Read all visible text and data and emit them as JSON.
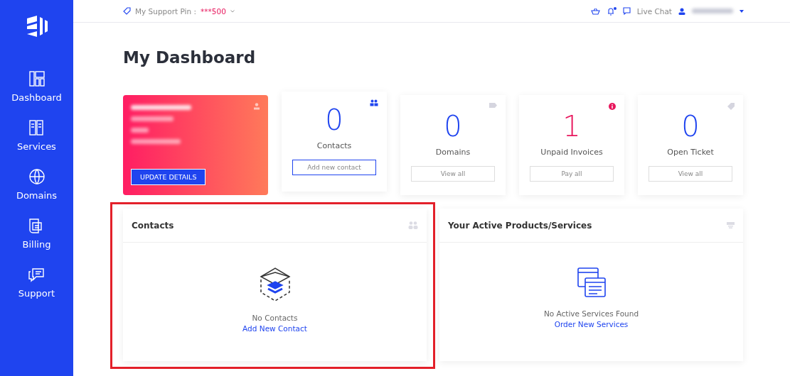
{
  "sidebar": {
    "items": [
      {
        "label": "Dashboard"
      },
      {
        "label": "Services"
      },
      {
        "label": "Domains"
      },
      {
        "label": "Billing"
      },
      {
        "label": "Support"
      }
    ]
  },
  "topbar": {
    "pin_label": "My Support Pin :",
    "pin_value": "***500",
    "live_chat": "Live Chat",
    "notification_dot": true
  },
  "title": "My Dashboard",
  "profile_card": {
    "button": "UPDATE DETAILS"
  },
  "stat_cards": [
    {
      "value": "0",
      "label": "Contacts",
      "button": "Add new contact",
      "alert": false,
      "primary": true
    },
    {
      "value": "0",
      "label": "Domains",
      "button": "View all",
      "alert": false,
      "primary": false
    },
    {
      "value": "1",
      "label": "Unpaid Invoices",
      "button": "Pay all",
      "alert": true,
      "primary": false
    },
    {
      "value": "0",
      "label": "Open Ticket",
      "button": "View all",
      "alert": false,
      "primary": false
    }
  ],
  "panels": [
    {
      "title": "Contacts",
      "empty_text": "No Contacts",
      "link": "Add New Contact",
      "highlighted": true
    },
    {
      "title": "Your Active Products/Services",
      "empty_text": "No Active Services Found",
      "link": "Order New Services",
      "highlighted": false
    }
  ]
}
